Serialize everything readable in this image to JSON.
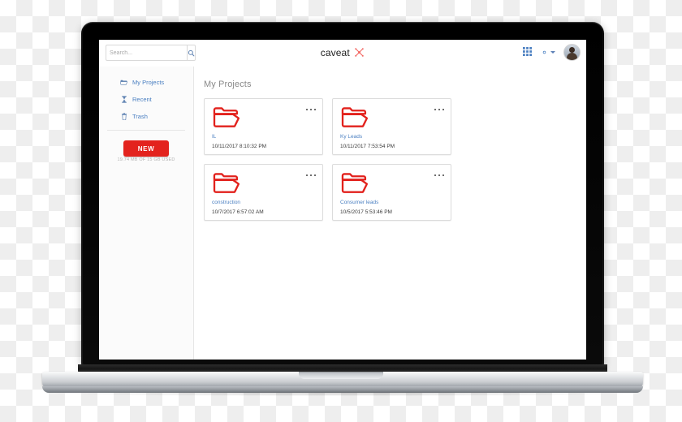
{
  "app": {
    "brand_text": "caveat",
    "brand_mark_icon": "caveat-logo-mark"
  },
  "search": {
    "placeholder": "Search...",
    "value": "",
    "button_icon": "search-icon"
  },
  "topbar": {
    "grid_view_icon": "grid-view-icon",
    "settings_icon": "gear-icon",
    "settings_caret_icon": "chevron-down-icon",
    "avatar_icon": "user-avatar"
  },
  "sidebar": {
    "items": [
      {
        "label": "My Projects",
        "icon": "folder-open-icon"
      },
      {
        "label": "Recent",
        "icon": "hourglass-icon"
      },
      {
        "label": "Trash",
        "icon": "trash-icon"
      }
    ],
    "new_button_label": "NEW",
    "storage_text": "19.74 MB OF 15 GB USED"
  },
  "main": {
    "title": "My Projects",
    "cards": [
      {
        "name": "IL",
        "date": "10/11/2017 8:10:32 PM",
        "icon": "folder-icon",
        "menu_icon": "more-horizontal-icon"
      },
      {
        "name": "Ky Leads",
        "date": "10/11/2017 7:53:54 PM",
        "icon": "folder-icon",
        "menu_icon": "more-horizontal-icon"
      },
      {
        "name": "construction",
        "date": "10/7/2017 6:57:02 AM",
        "icon": "folder-icon",
        "menu_icon": "more-horizontal-icon"
      },
      {
        "name": "Consumer leads",
        "date": "10/5/2017 5:53:46 PM",
        "icon": "folder-icon",
        "menu_icon": "more-horizontal-icon"
      }
    ]
  },
  "colors": {
    "accent_red": "#e3231e",
    "link_blue": "#4a7fc1",
    "folder_red": "#e2211c",
    "text_gray": "#8a8a8a"
  }
}
